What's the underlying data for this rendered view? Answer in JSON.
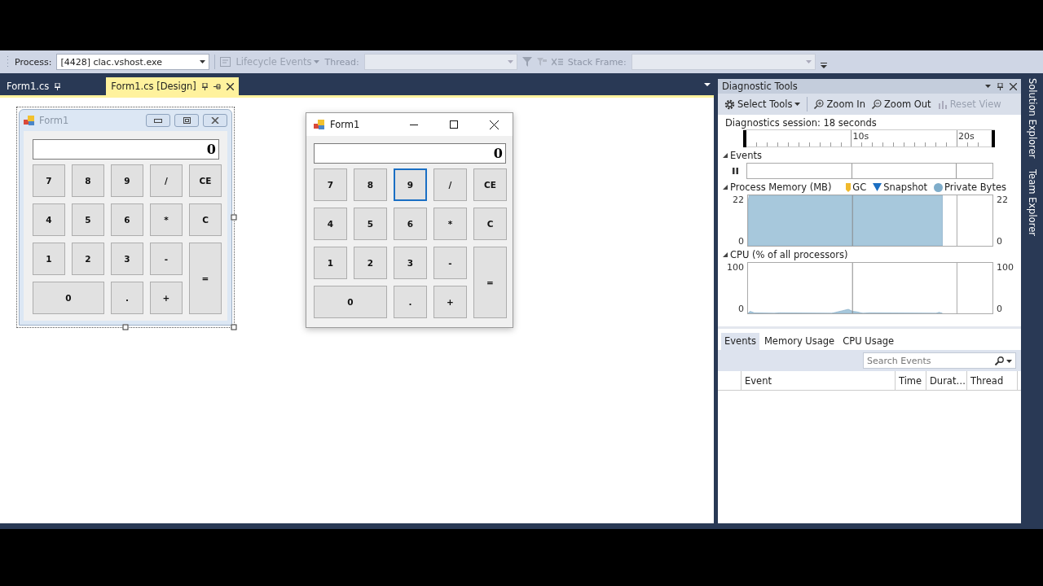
{
  "toolbar": {
    "process_label": "Process:",
    "process_value": "[4428] clac.vshost.exe",
    "lifecycle": {
      "label": "Lifecycle Events",
      "disabled": true
    },
    "thread": {
      "label": "Thread:",
      "disabled": true
    },
    "stack": {
      "label": "Stack Frame:",
      "disabled": true
    }
  },
  "doc_tabs": [
    {
      "label": "Form1.cs",
      "selected": false
    },
    {
      "label": "Form1.cs [Design]",
      "selected": true
    }
  ],
  "designer_form": {
    "title": "Form1",
    "display": "0",
    "buttons": [
      {
        "label": "7",
        "kind": "normal"
      },
      {
        "label": "8",
        "kind": "normal"
      },
      {
        "label": "9",
        "kind": "normal"
      },
      {
        "label": "/",
        "kind": "normal"
      },
      {
        "label": "CE",
        "kind": "normal"
      },
      {
        "label": "4",
        "kind": "normal"
      },
      {
        "label": "5",
        "kind": "normal"
      },
      {
        "label": "6",
        "kind": "normal"
      },
      {
        "label": "*",
        "kind": "normal"
      },
      {
        "label": "C",
        "kind": "normal"
      },
      {
        "label": "1",
        "kind": "normal"
      },
      {
        "label": "2",
        "kind": "normal"
      },
      {
        "label": "3",
        "kind": "normal"
      },
      {
        "label": "-",
        "kind": "normal"
      },
      {
        "label": "=",
        "kind": "tall"
      },
      {
        "label": "0",
        "kind": "wide"
      },
      {
        "label": ".",
        "kind": "normal"
      },
      {
        "label": "+",
        "kind": "normal"
      }
    ]
  },
  "running_form": {
    "title": "Form1",
    "display": "0",
    "buttons": [
      {
        "label": "7",
        "kind": "normal",
        "focused": false
      },
      {
        "label": "8",
        "kind": "normal",
        "focused": false
      },
      {
        "label": "9",
        "kind": "normal",
        "focused": true
      },
      {
        "label": "/",
        "kind": "normal",
        "focused": false
      },
      {
        "label": "CE",
        "kind": "normal",
        "focused": false
      },
      {
        "label": "4",
        "kind": "normal",
        "focused": false
      },
      {
        "label": "5",
        "kind": "normal",
        "focused": false
      },
      {
        "label": "6",
        "kind": "normal",
        "focused": false
      },
      {
        "label": "*",
        "kind": "normal",
        "focused": false
      },
      {
        "label": "C",
        "kind": "normal",
        "focused": false
      },
      {
        "label": "1",
        "kind": "normal",
        "focused": false
      },
      {
        "label": "2",
        "kind": "normal",
        "focused": false
      },
      {
        "label": "3",
        "kind": "normal",
        "focused": false
      },
      {
        "label": "-",
        "kind": "normal",
        "focused": false
      },
      {
        "label": "=",
        "kind": "tall",
        "focused": false
      },
      {
        "label": "0",
        "kind": "wide",
        "focused": false
      },
      {
        "label": ".",
        "kind": "normal",
        "focused": false
      },
      {
        "label": "+",
        "kind": "normal",
        "focused": false
      }
    ]
  },
  "diagnostic_tools": {
    "title": "Diagnostic Tools",
    "tools": [
      {
        "label": "Select Tools",
        "kind": "select",
        "disabled": false
      },
      {
        "label": "Zoom In",
        "kind": "zoom-in",
        "disabled": false
      },
      {
        "label": "Zoom Out",
        "kind": "zoom-out",
        "disabled": false
      },
      {
        "label": "Reset View",
        "kind": "reset",
        "disabled": true
      }
    ],
    "session": "Diagnostics session: 18 seconds",
    "ruler": [
      "10s",
      "20s"
    ],
    "events_section": {
      "title": "Events",
      "expanded": true
    },
    "memory_section": {
      "title": "Process Memory (MB)",
      "expanded": true,
      "legend": [
        {
          "label": "GC",
          "kind": "gc",
          "color": "#f0b92c"
        },
        {
          "label": "Snapshot",
          "kind": "snapshot",
          "color": "#1c6fc2"
        },
        {
          "label": "Private Bytes",
          "kind": "series",
          "color": "#7fadca"
        }
      ],
      "left_axis_labels": [
        "22",
        "0"
      ],
      "right_axis_labels": [
        "22",
        "0"
      ]
    },
    "cpu_section": {
      "title": "CPU (% of all processors)",
      "expanded": true,
      "left_axis_labels": [
        "100",
        "0"
      ],
      "right_axis_labels": [
        "100",
        "0"
      ]
    },
    "bottom_tabs": [
      {
        "label": "Events",
        "selected": true
      },
      {
        "label": "Memory Usage",
        "selected": false
      },
      {
        "label": "CPU Usage",
        "selected": false
      }
    ],
    "search": {
      "placeholder": "Search Events"
    },
    "columns": [
      "Event",
      "Time",
      "Durat…",
      "Thread"
    ]
  },
  "side_tabs": [
    "Solution Explorer",
    "Team Explorer"
  ]
}
